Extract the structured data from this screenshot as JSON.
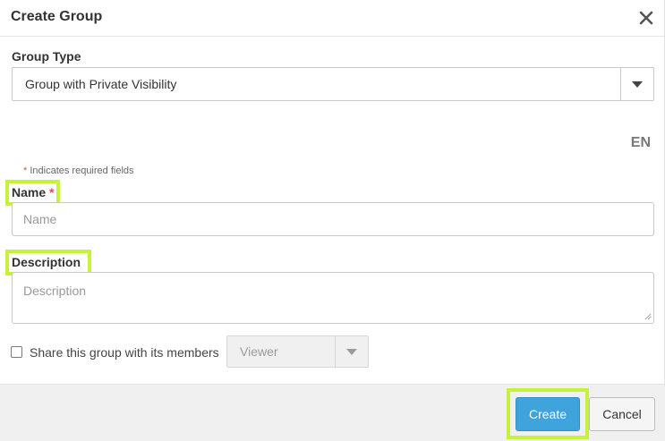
{
  "dialog": {
    "title": "Create Group",
    "close_icon": "close-icon"
  },
  "group_type": {
    "label": "Group Type",
    "selected": "Group with Private Visibility"
  },
  "language": "EN",
  "required_note": {
    "asterisk": "*",
    "text": " Indicates required fields"
  },
  "name_field": {
    "label": "Name",
    "required_marker": "*",
    "placeholder": "Name",
    "value": ""
  },
  "description_field": {
    "label": "Description",
    "placeholder": "Description",
    "value": ""
  },
  "share": {
    "label": "Share this group with its members",
    "checked": false,
    "role_selected": "Viewer"
  },
  "footer": {
    "create_label": "Create",
    "cancel_label": "Cancel"
  },
  "colors": {
    "primary": "#3fa3dc",
    "highlight": "#c7f23a",
    "required": "#d9534f"
  }
}
